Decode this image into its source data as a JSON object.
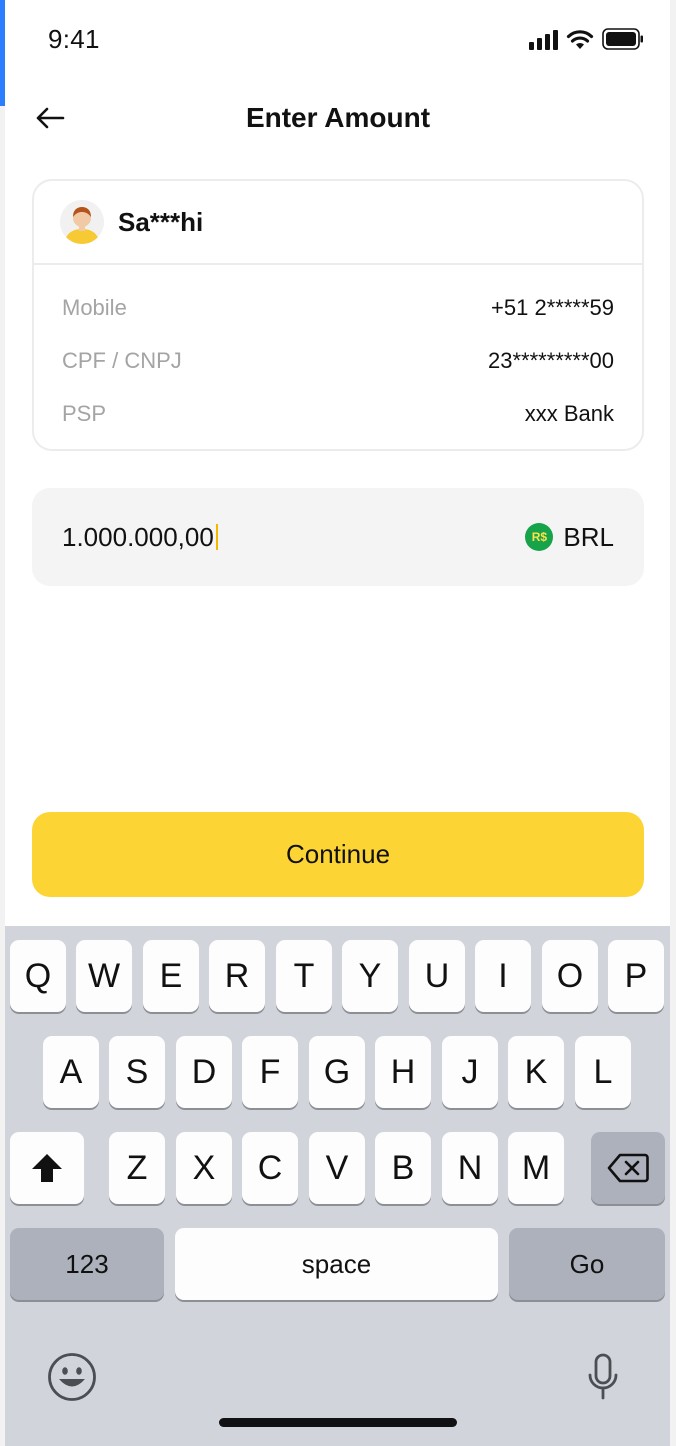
{
  "status_bar": {
    "time": "9:41"
  },
  "header": {
    "title": "Enter Amount"
  },
  "recipient": {
    "name": "Sa***hi",
    "rows": [
      {
        "label": "Mobile",
        "value": "+51 2*****59"
      },
      {
        "label": "CPF / CNPJ",
        "value": "23*********00"
      },
      {
        "label": "PSP",
        "value": "xxx Bank"
      }
    ]
  },
  "amount": {
    "value": "1.000.000,00",
    "currency_badge": "R$",
    "currency_code": "BRL"
  },
  "continue_label": "Continue",
  "keyboard": {
    "row1": [
      "Q",
      "W",
      "E",
      "R",
      "T",
      "Y",
      "U",
      "I",
      "O",
      "P"
    ],
    "row2": [
      "A",
      "S",
      "D",
      "F",
      "G",
      "H",
      "J",
      "K",
      "L"
    ],
    "row3": [
      "Z",
      "X",
      "C",
      "V",
      "B",
      "N",
      "M"
    ],
    "numbers_label": "123",
    "space_label": "space",
    "go_label": "Go"
  },
  "colors": {
    "accent": "#fcd534",
    "currency_badge": "#16a34a",
    "keyboard_bg": "#d1d4db"
  }
}
